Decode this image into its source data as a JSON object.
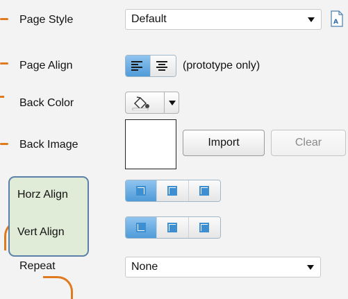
{
  "labels": {
    "page_style": "Page Style",
    "page_align": "Page Align",
    "back_color": "Back Color",
    "back_image": "Back Image",
    "horz_align": "Horz Align",
    "vert_align": "Vert Align",
    "repeat": "Repeat"
  },
  "page_style_select": {
    "value": "Default"
  },
  "page_align_note": "(prototype only)",
  "back_image_buttons": {
    "import": "Import",
    "clear": "Clear"
  },
  "repeat_select": {
    "value": "None"
  },
  "colors": {
    "accent_blue": "#4f9bd9",
    "callout_orange": "#e07a1f",
    "highlight_green": "#e1ecd8",
    "highlight_border": "#5a7fa8"
  }
}
